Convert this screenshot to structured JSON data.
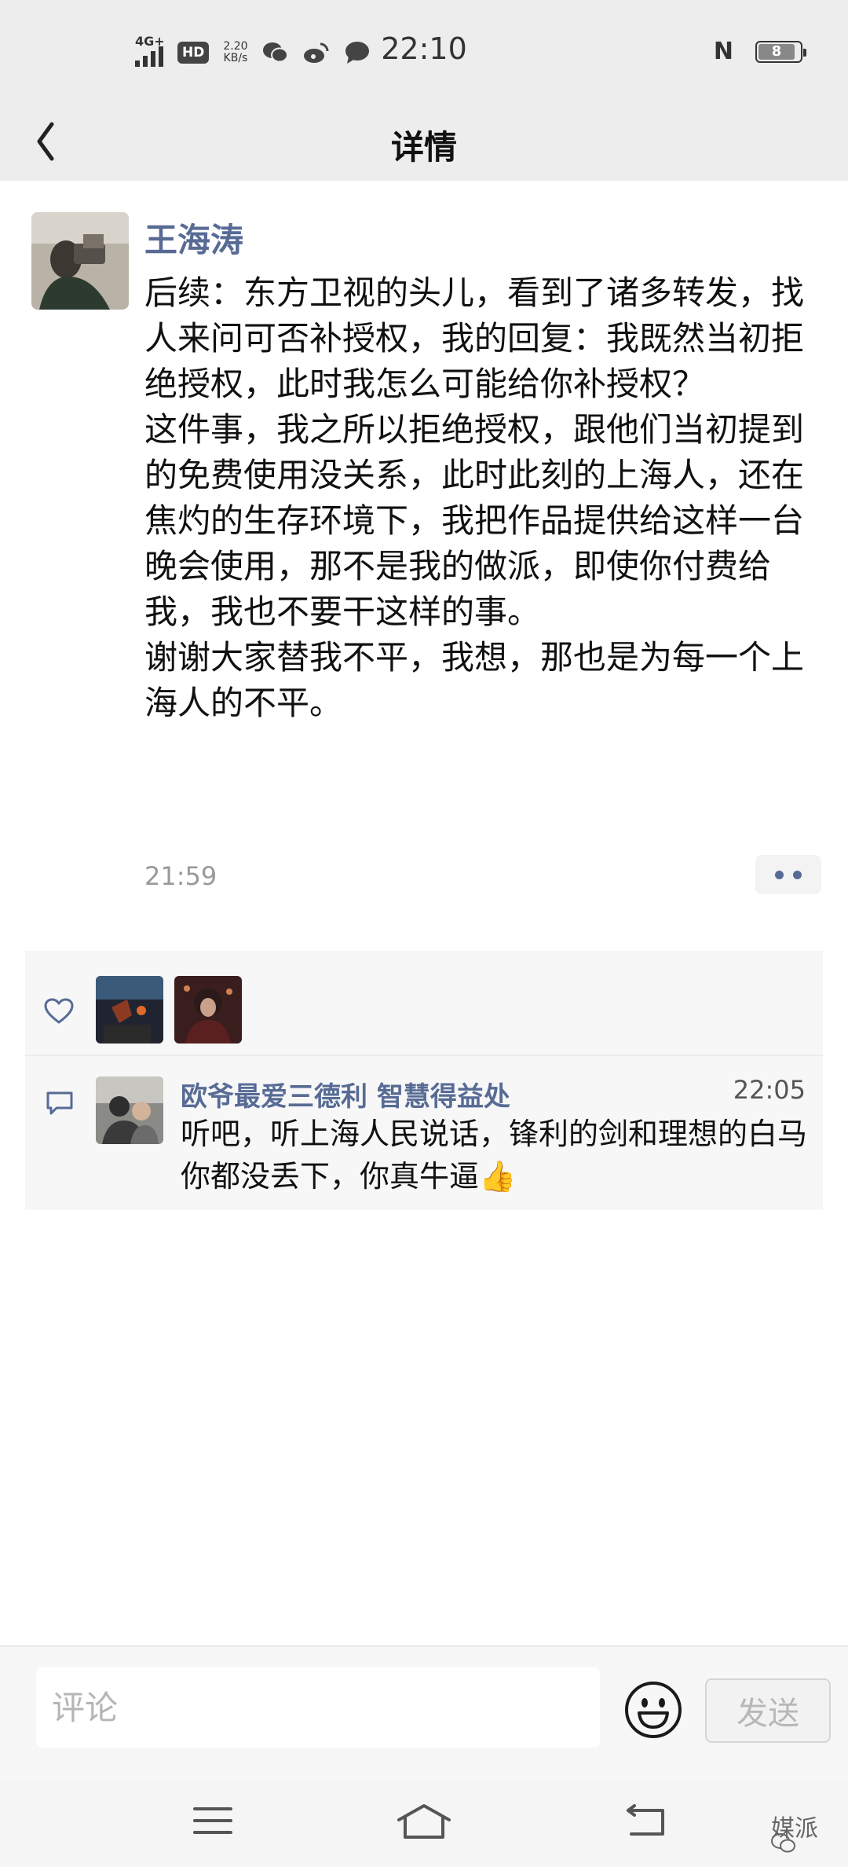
{
  "status_bar": {
    "network": "4G+",
    "hd": "HD",
    "speed_value": "2.20",
    "speed_unit": "KB/s",
    "time": "22:10",
    "nfc": "N",
    "battery": "8"
  },
  "nav": {
    "title": "详情"
  },
  "post": {
    "author": "王海涛",
    "text": "后续：东方卫视的头儿，看到了诸多转发，找人来问可否补授权，我的回复：我既然当初拒绝授权，此时我怎么可能给你补授权？\n这件事，我之所以拒绝授权，跟他们当初提到的免费使用没关系，此时此刻的上海人，还在焦灼的生存环境下，我把作品提供给这样一台晚会使用，那不是我的做派，即使你付费给我，我也不要干这样的事。\n谢谢大家替我不平，我想，那也是为每一个上海人的不平。",
    "time": "21:59"
  },
  "interactions": {
    "comment": {
      "name": "欧爷最爱三德利 智慧得益处",
      "time": "22:05",
      "text": "听吧，听上海人民说话，锋利的剑和理想的白马你都没丢下，你真牛逼👍"
    }
  },
  "input_bar": {
    "placeholder": "评论",
    "send_label": "发送"
  },
  "watermark": "媒派",
  "colors": {
    "link_blue": "#576b95",
    "header_bg": "#ededed",
    "panel_bg": "#f7f7f7"
  }
}
